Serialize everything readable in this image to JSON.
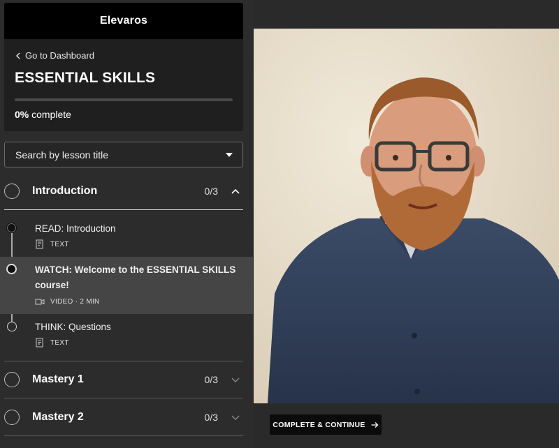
{
  "brand": "Elevaros",
  "back_link": "Go to Dashboard",
  "course_title": "ESSENTIAL SKILLS",
  "progress": {
    "percent": 0,
    "value_label": "0%",
    "suffix": "complete"
  },
  "search": {
    "label": "Search by lesson title"
  },
  "sections": [
    {
      "title": "Introduction",
      "count": "0/3",
      "expanded": true,
      "lessons": [
        {
          "title": "READ: Introduction",
          "type_icon": "text-doc-icon",
          "meta": "TEXT",
          "active": false
        },
        {
          "title": "WATCH: Welcome to the ESSENTIAL SKILLS course!",
          "type_icon": "video-camera-icon",
          "meta": "VIDEO · 2 MIN",
          "active": true
        },
        {
          "title": "THINK: Questions",
          "type_icon": "text-doc-icon",
          "meta": "TEXT",
          "active": false
        }
      ]
    },
    {
      "title": "Mastery 1",
      "count": "0/3",
      "expanded": false
    },
    {
      "title": "Mastery 2",
      "count": "0/3",
      "expanded": false
    }
  ],
  "video": {
    "subject": "presenter-video-frame"
  },
  "complete_button": "COMPLETE & CONTINUE",
  "colors": {
    "accent": "#000000",
    "sidebar_bg": "#2c2c2c",
    "active_row": "#454545",
    "video_backdrop": "#ece3d1"
  }
}
